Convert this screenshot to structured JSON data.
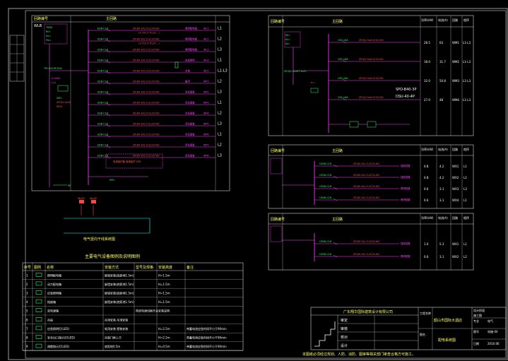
{
  "left_panel": {
    "header": {
      "col1": "回路编号",
      "col2": "主回路"
    },
    "incoming": {
      "label": "WLB",
      "breaker": "TM30"
    },
    "circuits": [
      {
        "breaker": "EDB-C16",
        "cable": "ZR-BV-3X2.5-SC20-WC",
        "cable2": "(3-7x2.5 TC20-...)",
        "desc": "照明配电箱",
        "id": "WL1",
        "phase": "L1"
      },
      {
        "breaker": "EDB-C16",
        "cable": "ZR-BV-3X2.5-SC20-WC",
        "cable2": "(3-7x2.5 TC20-...)",
        "desc": "照明配电箱",
        "id": "WL2",
        "phase": "L2"
      },
      {
        "breaker": "EDB-C16",
        "cable": "ZR-BV-3X2.5-SC20-WC",
        "cable2": "",
        "desc": "照明配电箱",
        "id": "WL3",
        "phase": "L3"
      },
      {
        "breaker": "EDB-C16",
        "cable": "ZR-BV-3X2.5-SC20-WC",
        "cable2": "",
        "desc": "应急照明",
        "id": "WL4",
        "phase": "L1"
      },
      {
        "breaker": "EDB-C16",
        "cable": "ZR-BV-3X2.5-SC20-WC",
        "cable2": "",
        "desc": "空调",
        "id": "WL5",
        "phase": "L1-L3"
      },
      {
        "breaker": "EDB-C16",
        "cable": "ZR-BV-3X2.5-SC20-WC",
        "cable2": "",
        "desc": "备用",
        "id": "WP1",
        "phase": "L2"
      },
      {
        "breaker": "EDB-C16",
        "cable": "ZR-BV-3X2.5-SC20-WC",
        "cable2": "",
        "desc": "风机盘管",
        "id": "WP2",
        "phase": "L3"
      },
      {
        "breaker": "EDB-C16",
        "cable": "ZR-BV-3X2.5-SC20-WC",
        "cable2": "",
        "desc": "风机盘管",
        "id": "WP3",
        "phase": "L1"
      },
      {
        "breaker": "EDB-C16",
        "cable": "ZR-BV-3X2.5-SC20-WC",
        "cable2": "",
        "desc": "风机盘管",
        "id": "WP4",
        "phase": "L2"
      },
      {
        "breaker": "EDB-C16",
        "cable": "ZR-BV-3X2.5-SC20-WC",
        "cable2": "",
        "desc": "风机盘管",
        "id": "WP5",
        "phase": "L3"
      },
      {
        "breaker": "EDB-C16",
        "cable": "ZR-BV-3X2.5-SC20-WC",
        "cable2": "",
        "desc": "风机盘管",
        "id": "WP6",
        "phase": "L1"
      },
      {
        "breaker": "EDB-C16",
        "cable": "ZR-BV-3X2.5-SC20-WC",
        "cable2": "",
        "desc": "风机盘管",
        "id": "WP7",
        "phase": "L2"
      },
      {
        "breaker": "EDB-C16",
        "cable": "ZR-BV-3X2.5-SC20-WC",
        "cable2": "",
        "desc": "风机盘管",
        "id": "WP8",
        "phase": "L3"
      }
    ],
    "spd_box": "电涌保护器 浪涌保护 SPD",
    "ground": "PE"
  },
  "riser": {
    "label1": "WLM1",
    "label2": "WLM2",
    "caption": "电气竖向干线系统图"
  },
  "legend": {
    "title": "主要电气设备图例及说明图例",
    "headers": [
      "序号",
      "图例",
      "名称",
      "安装方式",
      "型号及规格",
      "安装高度",
      "备注"
    ],
    "rows": [
      {
        "no": "1",
        "name": "照明配电箱",
        "mount": "嵌墙安装(底距地1.5m)",
        "spec": "",
        "height": "H=1.5m",
        "note": ""
      },
      {
        "no": "2",
        "name": "动力配电箱",
        "mount": "嵌墙安装(底距地1.5m)",
        "spec": "",
        "height": "H=1.5m",
        "note": ""
      },
      {
        "no": "3",
        "name": "应急照明箱",
        "mount": "嵌墙安装(底距地1.5m)",
        "spec": "",
        "height": "H=1.5m",
        "note": ""
      },
      {
        "no": "4",
        "name": "插座箱",
        "mount": "嵌墙安装(底距地1.5m)",
        "spec": "",
        "height": "H=1.5m",
        "note": ""
      },
      {
        "no": "5",
        "name": "双电源箱",
        "mount": "",
        "spec": "带双电源切换开关安装说明",
        "height": "",
        "note": ""
      },
      {
        "no": "6",
        "name": "吊扇",
        "mount": "吊顶安装  吊顶安装",
        "spec": "",
        "height": "",
        "note": ""
      },
      {
        "no": "7",
        "name": "应急照明灯(LED)",
        "mount": "吸顶安装 壁装安装",
        "spec": "",
        "height": "H=2.5m",
        "note": "带蓄电池应急时间不小于90min"
      },
      {
        "no": "8",
        "name": "安全出口指示灯(LED)",
        "mount": "吊装门框上方",
        "spec": "",
        "height": "H=2.2m",
        "note": "带蓄电池应急时间不小于90min"
      },
      {
        "no": "9",
        "name": "疏散指示灯(LED)",
        "mount": "底距地0.5m",
        "spec": "",
        "height": "H=0.5m",
        "note": "带蓄电池应急时间不小于90min"
      }
    ]
  },
  "right_top": {
    "header": {
      "col1": "回路编号",
      "col2": "主回路",
      "col3": "功率(kW)",
      "col4": "电流(A)",
      "col5": "回路",
      "col6": "相序"
    },
    "circuits": [
      {
        "breaker": "C65-16A",
        "cable": "ZR-YJV-5x6-SC32-WC",
        "kw": "28.5",
        "a": "63",
        "id": "WM1",
        "ph": "L1-L3"
      },
      {
        "breaker": "C65-16A",
        "cable": "ZR-YJV-5x6-SC32-WC",
        "kw": "18.0",
        "a": "31.7",
        "id": "WM2",
        "ph": "L1-L3"
      },
      {
        "breaker": "C65-16A",
        "cable": "ZR-YJV-5x6-SC32-WC",
        "kw": "32.0",
        "a": "50.8",
        "id": "WM3",
        "ph": "L1-L3"
      },
      {
        "breaker": "C65-16A",
        "cable": "ZR-YJV-5x6-SC32-WC",
        "kw": "27.0",
        "a": "48",
        "id": "WM4",
        "ph": "L1-L3"
      }
    ],
    "mid_label": "ZR-YJV-4x50+1x25",
    "notes": [
      "SPD-B40-3P",
      "DSU-40-4P"
    ]
  },
  "right_mid": {
    "header": {
      "col1": "回路编号",
      "col2": "主回路",
      "col3": "功率(kW)",
      "col4": "电流(A)",
      "col5": "回路",
      "col6": "相序"
    },
    "circuits": [
      {
        "breaker": "C65N-C16",
        "cable": "ZR-BV-3x2.5-SC20-WC",
        "desc": "插座回路",
        "kw": "0.8",
        "a": "4.2",
        "id": "WX1",
        "ph": "L1"
      },
      {
        "breaker": "C65N-C16",
        "cable": "ZR-BV-3x2.5-SC20-WC",
        "desc": "插座回路",
        "kw": "0.8",
        "a": "4.2",
        "id": "WX2",
        "ph": "L2"
      },
      {
        "breaker": "C65N-C16",
        "cable": "ZR-BV-3x2.5-SC20-WC",
        "desc": "照明回路",
        "kw": "0.6",
        "a": "3.1",
        "id": "WX3",
        "ph": "L3"
      },
      {
        "breaker": "C65N-C16",
        "cable": "ZR-BV-3x2.5-SC20-WC",
        "desc": "照明回路",
        "kw": "0.6",
        "a": "3.1",
        "id": "WX4",
        "ph": "L1"
      }
    ]
  },
  "right_bot": {
    "header": {
      "col1": "回路编号",
      "col2": "主回路",
      "col3": "功率(kW)",
      "col4": "电流(A)",
      "col5": "回路",
      "col6": "相序"
    },
    "circuits": [
      {
        "breaker": "C65N-C16",
        "cable": "ZR-BV-3x2.5-SC20-WC",
        "desc": "插座回路",
        "kw": "1.0",
        "a": "5.3",
        "id": "WX1",
        "ph": "L1"
      },
      {
        "breaker": "C65N-C16",
        "cable": "ZR-BV-3x2.5-SC20-WC",
        "desc": "照明回路",
        "kw": "0.6",
        "a": "3.1",
        "id": "WX2",
        "ph": "L2"
      }
    ]
  },
  "title_block": {
    "company": "广东翔华国际建筑设计有限公司",
    "project_label": "工程名称",
    "project": "韶山市国际大酒店",
    "drawing_label": "图名",
    "drawing": "配电系统图",
    "roles": [
      "审定",
      "审核",
      "校对",
      "设计"
    ],
    "stage_label": "设计阶段",
    "stage": "施工图",
    "spec_label": "专业",
    "spec": "电气",
    "no_label": "图号",
    "no": "电施-04",
    "date_label": "日期",
    "date": "2010.06"
  },
  "footer_note": "本图纸必须经过规划、人防、消防、图审等相关部门审查合格方可施工。"
}
